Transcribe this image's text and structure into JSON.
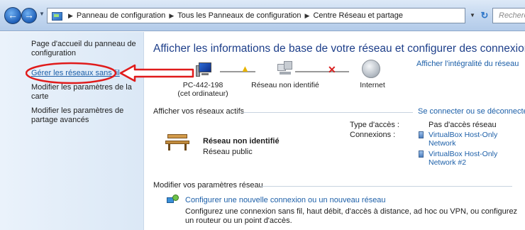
{
  "window": {
    "breadcrumbs": [
      "Panneau de configuration",
      "Tous les Panneaux de configuration",
      "Centre Réseau et partage"
    ],
    "search_placeholder": "Recherche"
  },
  "sidebar": {
    "items": [
      {
        "label": "Page d'accueil du panneau de configuration"
      },
      {
        "label": "Gérer les réseaux sans fil"
      },
      {
        "label": "Modifier les paramètres de la carte"
      },
      {
        "label": "Modifier les paramètres de partage avancés"
      }
    ]
  },
  "main": {
    "title": "Afficher les informations de base de votre réseau et configurer des connexions",
    "full_map_link": "Afficher l'intégralité du réseau",
    "network_map": {
      "computer_name": "PC-442-198",
      "computer_sub": "(cet ordinateur)",
      "middle_node": "Réseau non identifié",
      "end_node": "Internet"
    },
    "active_networks": {
      "header": "Afficher vos réseaux actifs",
      "connect_link": "Se connecter ou se déconnecter",
      "network_name": "Réseau non identifié",
      "network_type": "Réseau public",
      "access_type_label": "Type d'accès :",
      "access_type_value": "Pas d'accès réseau",
      "connections_label": "Connexions :",
      "connections": [
        "VirtualBox Host-Only Network",
        "VirtualBox Host-Only Network #2"
      ]
    },
    "settings": {
      "header": "Modifier vos paramètres réseau",
      "setup_link": "Configurer une nouvelle connexion ou un nouveau réseau",
      "setup_desc": "Configurez une connexion sans fil, haut débit, d'accès à distance, ad hoc ou VPN, ou configurez un routeur ou un point d'accès."
    }
  },
  "colors": {
    "link": "#1c5fa8",
    "title": "#1e3f8a",
    "annotation": "#e01b1b"
  }
}
